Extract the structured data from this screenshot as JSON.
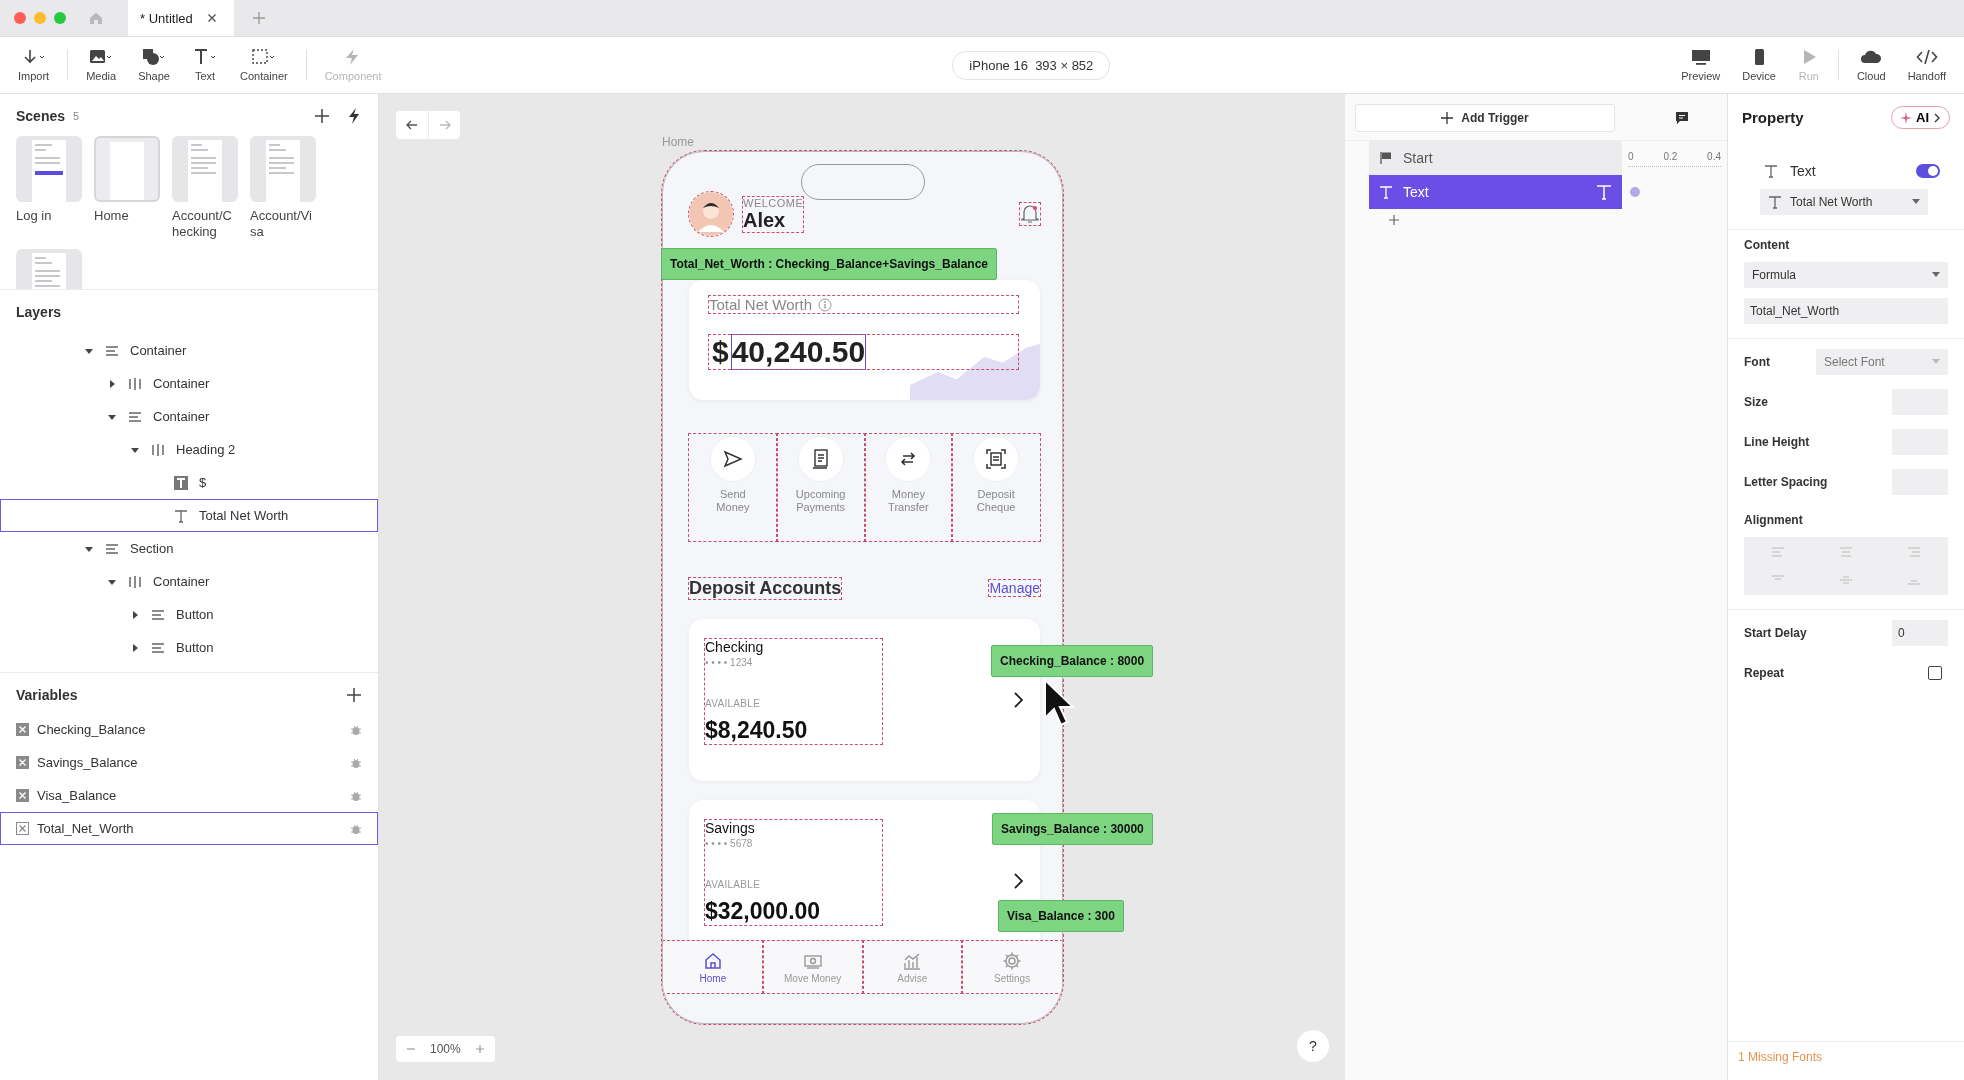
{
  "window": {
    "tab": {
      "label": "* Untitled",
      "selected": true
    }
  },
  "toolbar": {
    "tools": [
      {
        "label": "Import",
        "kind": "import",
        "disabled": false
      },
      {
        "label": "Media",
        "kind": "media",
        "disabled": false
      },
      {
        "label": "Shape",
        "kind": "shape",
        "disabled": false
      },
      {
        "label": "Text",
        "kind": "text",
        "disabled": false
      },
      {
        "label": "Container",
        "kind": "container",
        "disabled": false
      },
      {
        "label": "Component",
        "kind": "component",
        "disabled": true
      }
    ],
    "device": "iPhone 16  393 × 852",
    "actions": [
      {
        "label": "Preview",
        "kind": "preview",
        "disabled": false
      },
      {
        "label": "Device",
        "kind": "device",
        "disabled": false
      },
      {
        "label": "Run",
        "kind": "run",
        "disabled": true
      },
      {
        "label": "Cloud",
        "kind": "cloud",
        "disabled": false
      },
      {
        "label": "Handoff",
        "kind": "handoff",
        "disabled": false
      }
    ]
  },
  "scenes": {
    "title": "Scenes",
    "count": "5",
    "items": [
      {
        "label": "Log in",
        "kind": "login",
        "selected": false
      },
      {
        "label": "Home",
        "kind": "blank",
        "selected": true
      },
      {
        "label": "Account/Checking",
        "kind": "account",
        "selected": false
      },
      {
        "label": "Account/Visa",
        "kind": "account",
        "selected": false
      },
      {
        "kind": "detail",
        "selected": false
      }
    ]
  },
  "layers": {
    "title": "Layers",
    "items": [
      {
        "label": "Container",
        "kind": "stack",
        "expanded": true,
        "selected": false,
        "children": [
          {
            "label": "Container",
            "kind": "row",
            "expanded": false,
            "selected": false
          },
          {
            "label": "Container",
            "kind": "stack",
            "expanded": true,
            "selected": false,
            "children": [
              {
                "label": "Heading 2",
                "kind": "row",
                "expanded": true,
                "selected": false,
                "children": [
                  {
                    "label": "$",
                    "kind": "text-box",
                    "selected": false
                  },
                  {
                    "label": "Total Net Worth",
                    "kind": "text",
                    "selected": true
                  }
                ]
              }
            ]
          }
        ]
      },
      {
        "label": "Section",
        "kind": "stack",
        "expanded": true,
        "selected": false,
        "children": [
          {
            "label": "Container",
            "kind": "row",
            "expanded": true,
            "selected": false,
            "children": [
              {
                "label": "Button",
                "kind": "stack",
                "expanded": false,
                "selected": false
              },
              {
                "label": "Button",
                "kind": "stack",
                "expanded": false,
                "selected": false
              }
            ]
          }
        ]
      }
    ]
  },
  "variables": {
    "title": "Variables",
    "items": [
      {
        "name": "Checking_Balance",
        "selected": false
      },
      {
        "name": "Savings_Balance",
        "selected": false
      },
      {
        "name": "Visa_Balance",
        "selected": false
      },
      {
        "name": "Total_Net_Worth",
        "selected": true
      }
    ]
  },
  "canvas": {
    "frame_label": "Home",
    "zoom": "100%",
    "help": "?",
    "tags": [
      "Total_Net_Worth : Checking_Balance+Savings_Balance",
      "Checking_Balance : 8000",
      "Savings_Balance : 30000",
      "Visa_Balance : 300"
    ],
    "phone": {
      "welcome": "WELCOME",
      "user": "Alex",
      "net_worth": {
        "label": "Total Net Worth",
        "currency": "$",
        "amount": "40,240.50"
      },
      "quick_actions": [
        {
          "label": "Send Money",
          "kind": "send"
        },
        {
          "label": "Upcoming Payments",
          "kind": "bill"
        },
        {
          "label": "Money Transfer",
          "kind": "transfer"
        },
        {
          "label": "Deposit Cheque",
          "kind": "scan"
        }
      ],
      "section_title": "Deposit Accounts",
      "section_link": "Manage",
      "accounts": [
        {
          "name": "Checking",
          "number": "• • • • 1234",
          "caption": "AVAILABLE",
          "balance": "$8,240.50"
        },
        {
          "name": "Savings",
          "number": "• • • • 5678",
          "caption": "AVAILABLE",
          "balance": "$32,000.00"
        }
      ],
      "nav": [
        {
          "label": "Home",
          "kind": "home",
          "selected": true
        },
        {
          "label": "Move Money",
          "kind": "money",
          "selected": false
        },
        {
          "label": "Advise",
          "kind": "chart",
          "selected": false
        },
        {
          "label": "Settings",
          "kind": "gear",
          "selected": false
        }
      ]
    }
  },
  "triggers": {
    "add": "Add Trigger",
    "ticks": [
      "0",
      "0.2",
      "0.4"
    ],
    "rows": [
      {
        "label": "Start",
        "kind": "start",
        "selected": false
      },
      {
        "label": "Text",
        "kind": "text",
        "selected": true
      }
    ]
  },
  "property": {
    "title": "Property",
    "ai": "AI",
    "element": "Text",
    "enabled": true,
    "target": "Total Net Worth",
    "content_label": "Content",
    "content_mode": "Formula",
    "formula": "Total_Net_Worth",
    "font_label": "Font",
    "font_placeholder": "Select Font",
    "fields": [
      "Size",
      "Line Height",
      "Letter Spacing"
    ],
    "alignment_label": "Alignment",
    "delay_label": "Start Delay",
    "delay": "0",
    "repeat_label": "Repeat",
    "repeat": false,
    "footer": "1 Missing Fonts"
  }
}
